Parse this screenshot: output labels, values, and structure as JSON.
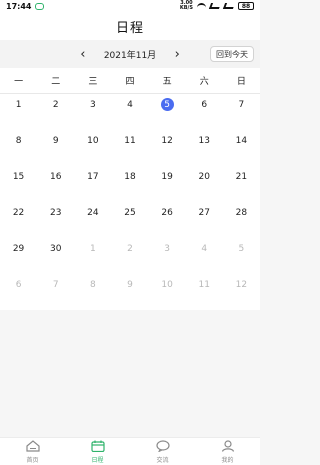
{
  "status_bar": {
    "time": "17:44",
    "net_speed_value": "3.00",
    "net_speed_unit": "KB/S",
    "battery": "88"
  },
  "header": {
    "title": "日程"
  },
  "month_nav": {
    "prev_icon": "‹",
    "label": "2021年11月",
    "next_icon": "›",
    "today_button": "回到今天"
  },
  "calendar": {
    "weekdays": [
      "一",
      "二",
      "三",
      "四",
      "五",
      "六",
      "日"
    ],
    "weeks": [
      [
        {
          "d": "1",
          "o": false
        },
        {
          "d": "2",
          "o": false
        },
        {
          "d": "3",
          "o": false
        },
        {
          "d": "4",
          "o": false
        },
        {
          "d": "5",
          "o": false,
          "today": true
        },
        {
          "d": "6",
          "o": false
        },
        {
          "d": "7",
          "o": false
        }
      ],
      [
        {
          "d": "8",
          "o": false
        },
        {
          "d": "9",
          "o": false
        },
        {
          "d": "10",
          "o": false
        },
        {
          "d": "11",
          "o": false
        },
        {
          "d": "12",
          "o": false
        },
        {
          "d": "13",
          "o": false
        },
        {
          "d": "14",
          "o": false
        }
      ],
      [
        {
          "d": "15",
          "o": false
        },
        {
          "d": "16",
          "o": false
        },
        {
          "d": "17",
          "o": false
        },
        {
          "d": "18",
          "o": false
        },
        {
          "d": "19",
          "o": false
        },
        {
          "d": "20",
          "o": false
        },
        {
          "d": "21",
          "o": false
        }
      ],
      [
        {
          "d": "22",
          "o": false
        },
        {
          "d": "23",
          "o": false
        },
        {
          "d": "24",
          "o": false
        },
        {
          "d": "25",
          "o": false
        },
        {
          "d": "26",
          "o": false
        },
        {
          "d": "27",
          "o": false
        },
        {
          "d": "28",
          "o": false
        }
      ],
      [
        {
          "d": "29",
          "o": false
        },
        {
          "d": "30",
          "o": false
        },
        {
          "d": "1",
          "o": true
        },
        {
          "d": "2",
          "o": true
        },
        {
          "d": "3",
          "o": true
        },
        {
          "d": "4",
          "o": true
        },
        {
          "d": "5",
          "o": true
        }
      ],
      [
        {
          "d": "6",
          "o": true
        },
        {
          "d": "7",
          "o": true
        },
        {
          "d": "8",
          "o": true
        },
        {
          "d": "9",
          "o": true
        },
        {
          "d": "10",
          "o": true
        },
        {
          "d": "11",
          "o": true
        },
        {
          "d": "12",
          "o": true
        }
      ]
    ]
  },
  "tab_bar": {
    "tabs": [
      {
        "label": "首页",
        "icon": "home-icon",
        "active": false
      },
      {
        "label": "日程",
        "icon": "calendar-icon",
        "active": true
      },
      {
        "label": "交流",
        "icon": "chat-icon",
        "active": false
      },
      {
        "label": "我的",
        "icon": "profile-icon",
        "active": false
      }
    ]
  },
  "colors": {
    "accent_green": "#2fb36b",
    "today_blue": "#4a6cf0"
  }
}
